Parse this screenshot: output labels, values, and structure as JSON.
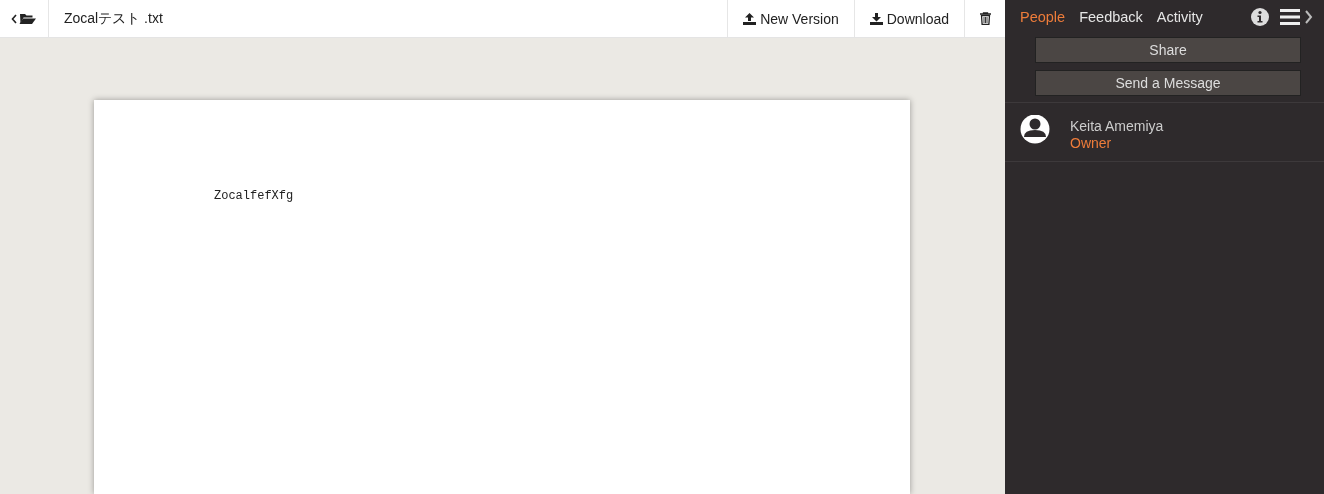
{
  "file": {
    "name": "Zocalテスト .txt"
  },
  "toolbar": {
    "buttons": [
      {
        "label": "New Version",
        "kind": "upload"
      },
      {
        "label": "Download",
        "kind": "download"
      }
    ]
  },
  "document": {
    "text": "ZocalfefXfg"
  },
  "sidebar": {
    "tabs": [
      {
        "label": "People",
        "selected": true
      },
      {
        "label": "Feedback",
        "selected": false
      },
      {
        "label": "Activity",
        "selected": false
      }
    ],
    "actions": [
      "Share",
      "Send a Message"
    ],
    "people": [
      {
        "name": "Keita Amemiya",
        "role": "Owner"
      }
    ]
  }
}
